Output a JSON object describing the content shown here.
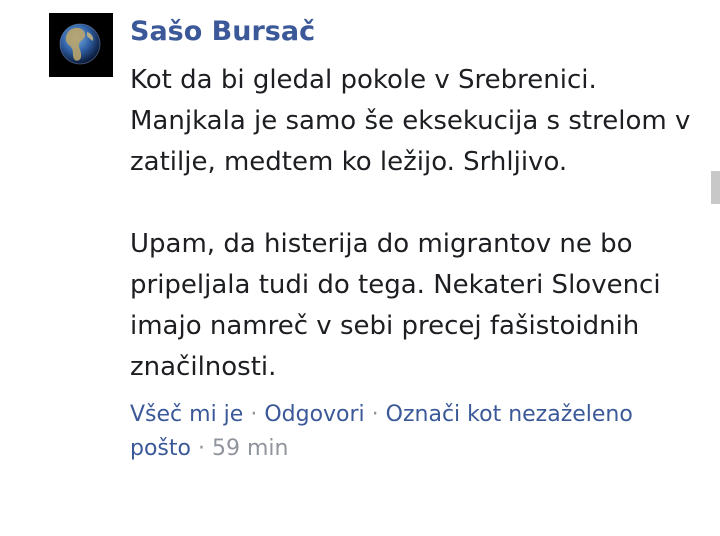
{
  "comment": {
    "author": "Sašo Bursač",
    "paragraphs": [
      "Kot da bi gledal pokole v Srebrenici. Manjkala je samo še eksekucija s strelom v zatilje, medtem ko ležijo. Srhljivo.",
      "Upam, da histerija do migrantov ne bo pripeljala tudi do tega. Nekateri Slovenci imajo namreč v sebi precej fašistoidnih značilnosti."
    ],
    "actions": {
      "like_label": "Všeč mi je",
      "reply_label": "Odgovori",
      "spam_label": "Označi kot nezaželeno pošto",
      "separator": "·",
      "time": "59 min"
    }
  },
  "avatar": {
    "icon": "globe-icon"
  },
  "colors": {
    "link": "#3b5998",
    "text": "#1c1e21",
    "meta": "#90949c"
  }
}
